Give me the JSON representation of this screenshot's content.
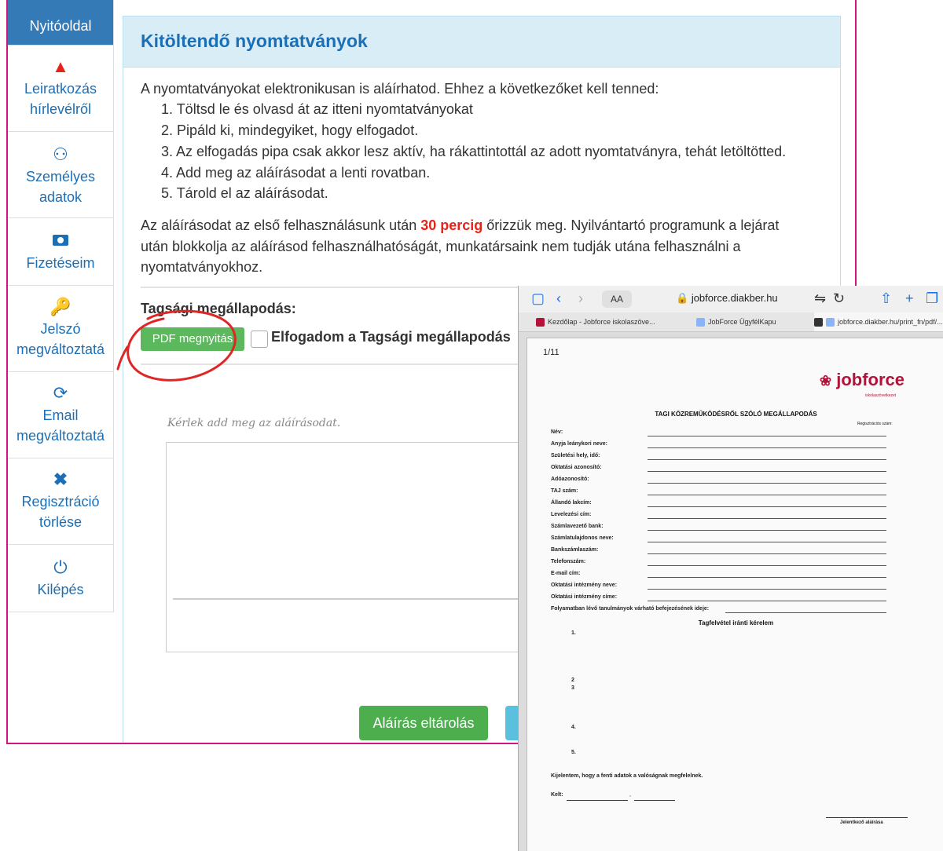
{
  "sidebar": {
    "items": [
      {
        "label": "Nyitóoldal",
        "icon": "home-icon"
      },
      {
        "label": "Leiratkozás hírlevélről",
        "icon": "warning-icon"
      },
      {
        "label": "Személyes adatok",
        "icon": "user-icon"
      },
      {
        "label": "Fizetéseim",
        "icon": "money-icon"
      },
      {
        "label": "Jelszó megváltoztatá",
        "icon": "key-icon"
      },
      {
        "label": "Email megváltoztatá",
        "icon": "refresh-icon"
      },
      {
        "label": "Regisztráció törlése",
        "icon": "x-icon"
      },
      {
        "label": "Kilépés",
        "icon": "power-icon"
      }
    ]
  },
  "panel": {
    "title": "Kitöltendő nyomtatványok",
    "intro": "A nyomtatványokat elektronikusan is aláírhatod. Ehhez a következőket kell tenned:",
    "steps": [
      "1. Töltsd le és olvasd át az itteni nyomtatványokat",
      "2. Pipáld ki, mindegyiket, hogy elfogadot.",
      "3. Az elfogadás pipa csak akkor lesz aktív, ha rákattintottál az adott nyomtatványra, tehát letöltötted.",
      "4. Add meg az aláírásodat a lenti rovatban.",
      "5. Tárold el az aláírásodat."
    ],
    "notice_pre": "Az aláírásodat az első felhasználásunk után ",
    "notice_highlight": "30 percig",
    "notice_post": " őrizzük meg. Nyilvántartó programunk a lejárat",
    "notice_line2": "után blokkolja az aláírásod felhasználhatóságát, munkatársaink nem tudják utána felhasználni a",
    "notice_line3": "nyomtatványokhoz.",
    "membership_label": "Tagsági megállapodás:",
    "pdf_button": "PDF megnyitás",
    "accept_label": "Elfogadom a Tagsági megállapodás",
    "signature_prompt": "Kérlek add meg az aláírásodat.",
    "save_button": "Aláírás eltárolás"
  },
  "browser": {
    "aa_label": "AA",
    "url": "jobforce.diakber.hu",
    "tabs": [
      "Kezdőlap - Jobforce iskolaszöve...",
      "JobForce ÜgyfélKapu",
      "jobforce.diakber.hu/print_fn/pdf/..."
    ]
  },
  "pdf": {
    "page": "1/11",
    "logo": "jobforce",
    "logo_sub": "iskolaszövetkezet",
    "title": "TAGI KÖZREMŰKÖDÉSRŐL SZÓLÓ MEGÁLLAPODÁS",
    "reg_label": "Regisztrációs szám:",
    "fields": [
      "Név:",
      "Anyja leánykori neve:",
      "Születési hely, idő:",
      "Oktatási azonosító:",
      "Adóazonosító:",
      "TAJ szám:",
      "Állandó lakcím:",
      "Levelezési cím:",
      "Számlavezető bank:",
      "Számlatulajdonos neve:",
      "Bankszámlaszám:",
      "Telefonszám:",
      "E-mail cím:",
      "Oktatási intézmény neve:",
      "Oktatási intézmény címe:",
      "Folyamatban lévő tanulmányok várható befejezésének ideje:"
    ],
    "subtitle": "Tagfelvétel iránti kérelem",
    "numbers": [
      "1.",
      "2",
      "3",
      "4.",
      "5."
    ],
    "declaration": "Kijelentem, hogy a fenti adatok a valóságnak megfelelnek.",
    "kelt": "Kelt:",
    "signature_label": "Jelentkező aláírása"
  }
}
